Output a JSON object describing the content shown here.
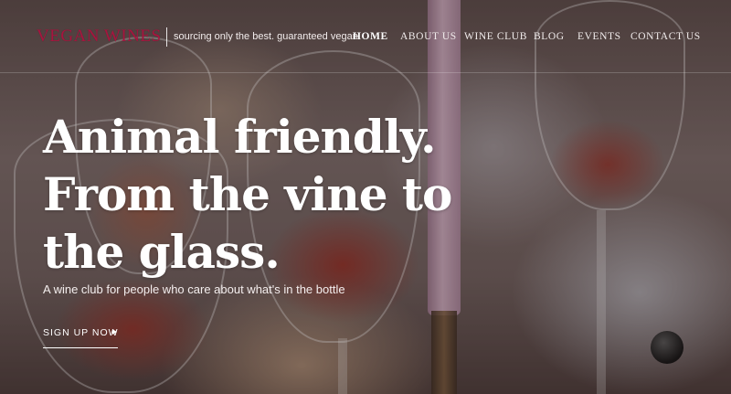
{
  "header": {
    "logo": "VEGAN WINES",
    "tagline": "sourcing only the best. guaranteed vegan",
    "nav": [
      {
        "label": "HOME",
        "active": true
      },
      {
        "label": "ABOUT US",
        "active": false
      },
      {
        "label": "WINE CLUB",
        "active": false
      },
      {
        "label": "BLOG",
        "active": false
      },
      {
        "label": "EVENTS",
        "active": false
      },
      {
        "label": "CONTACT US",
        "active": false
      }
    ]
  },
  "hero": {
    "title_lines": [
      "Animal friendly.",
      "From the vine to",
      "the glass."
    ],
    "subtitle": "A wine club for people who care about what's in the bottle",
    "cta_label": "SIGN UP NOW",
    "cta_icon": "triangle-right-icon"
  },
  "colors": {
    "logo": "#a8143e",
    "text": "#ffffff"
  }
}
